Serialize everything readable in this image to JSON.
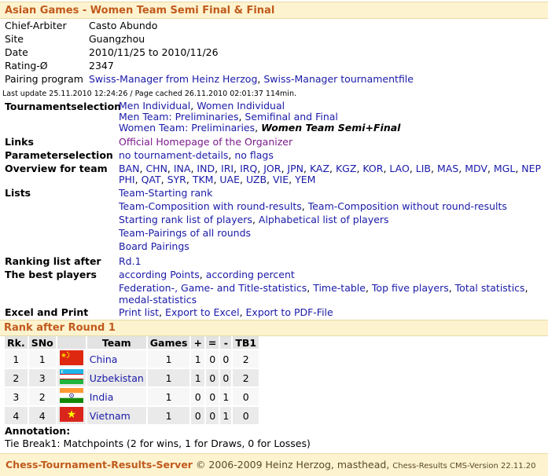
{
  "page": {
    "title": "Asian Games - Women Team Semi Final & Final"
  },
  "info": [
    {
      "key": "Chief-Arbiter",
      "value": "Casto Abundo"
    },
    {
      "key": "Site",
      "value": "Guangzhou"
    },
    {
      "key": "Date",
      "value": "2010/11/25 to 2010/11/26"
    },
    {
      "key": "Rating-Ø",
      "value": "2347"
    }
  ],
  "pairing": {
    "key": "Pairing program",
    "link1": "Swiss-Manager from Heinz Herzog",
    "sep": ", ",
    "link2": "Swiss-Manager tournamentfile"
  },
  "last_update": "Last update 25.11.2010 12:24:26 / Page cached 26.11.2010 02:01:37 114min.",
  "tournament_selection": {
    "label": "Tournamentselection",
    "line1": {
      "a": "Men Individual",
      "sep": ", ",
      "b": "Women Individual"
    },
    "line2": {
      "a": "Men Team: Preliminaries",
      "sep": ", ",
      "b": "Semifinal and Final"
    },
    "line3": {
      "a": "Women Team: Preliminaries",
      "sep": ", ",
      "current": "Women Team Semi+Final"
    }
  },
  "links": {
    "label": "Links",
    "homepage": "Official Homepage of the Organizer"
  },
  "parameter_selection": {
    "label": "Parameterselection",
    "a": "no tournament-details",
    "sep": ", ",
    "b": "no flags"
  },
  "overview": {
    "label": "Overview for team",
    "row1": [
      "BAN",
      "CHN",
      "INA",
      "IND",
      "IRI",
      "IRQ",
      "JOR",
      "JPN",
      "KAZ",
      "KGZ",
      "KOR",
      "LAO",
      "LIB",
      "MAS",
      "MDV",
      "MGL",
      "NEP"
    ],
    "row2": [
      "PHI",
      "QAT",
      "SYR",
      "TKM",
      "UAE",
      "UZB",
      "VIE",
      "YEM"
    ]
  },
  "lists": {
    "label": "Lists",
    "l1": "Team-Starting rank",
    "l2a": "Team-Composition with round-results",
    "l2b": "Team-Composition without round-results",
    "l3a": "Starting rank list of players",
    "l3b": "Alphabetical list of players",
    "l4": "Team-Pairings of all rounds",
    "l5": "Board Pairings",
    "sep": ", "
  },
  "ranking_after": {
    "label": "Ranking list after",
    "link": "Rd.1"
  },
  "best_players": {
    "label": "The best players",
    "a": "according Points",
    "b": "according percent",
    "s1": "Federation-, Game- and Title-statistics",
    "s2": "Time-table",
    "s3": "Top five players",
    "s4": "Total statistics",
    "s5": "medal-statistics",
    "sep": ", "
  },
  "excel": {
    "label": "Excel and Print",
    "a": "Print list",
    "b": "Export to Excel",
    "c": "Export to PDF-File",
    "sep": ", "
  },
  "rank_section": {
    "title": "Rank after Round 1"
  },
  "rank_table": {
    "headers": [
      "Rk.",
      "SNo",
      "",
      "Team",
      "Games",
      "+",
      "=",
      "-",
      "TB1"
    ],
    "rows": [
      {
        "rk": "1",
        "sno": "1",
        "flag": "china-flag",
        "team": "China",
        "games": "1",
        "w": "1",
        "d": "0",
        "l": "0",
        "tb1": "2"
      },
      {
        "rk": "2",
        "sno": "3",
        "flag": "uzbekistan-flag",
        "team": "Uzbekistan",
        "games": "1",
        "w": "1",
        "d": "0",
        "l": "0",
        "tb1": "2"
      },
      {
        "rk": "3",
        "sno": "2",
        "flag": "india-flag",
        "team": "India",
        "games": "1",
        "w": "0",
        "d": "0",
        "l": "1",
        "tb1": "0"
      },
      {
        "rk": "4",
        "sno": "4",
        "flag": "vietnam-flag",
        "team": "Vietnam",
        "games": "1",
        "w": "0",
        "d": "0",
        "l": "1",
        "tb1": "0"
      }
    ]
  },
  "annotation": {
    "heading": "Annotation:",
    "text": "Tie Break1: Matchpoints (2 for wins, 1 for Draws, 0 for Losses)"
  },
  "footer": {
    "server": "Chess-Tournament-Results-Server",
    "copyright": " © 2006-2009 Heinz Herzog, masthead, ",
    "cms": "Chess-Results CMS-Version 22.11.20"
  },
  "colors": {
    "accent": "#c15a1d",
    "band": "#fdf3cf",
    "link": "#1a1aa8",
    "visited": "#7a1a8a"
  }
}
